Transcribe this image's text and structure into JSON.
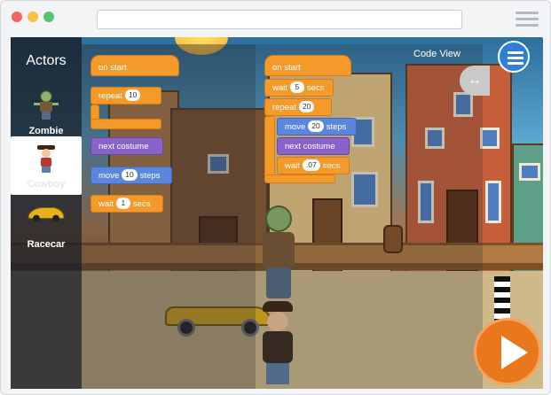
{
  "window": {
    "controls": [
      "close",
      "minimize",
      "zoom"
    ],
    "url": ""
  },
  "actors": {
    "title": "Actors",
    "items": [
      {
        "label": "Zombie",
        "icon": "zombie-icon"
      },
      {
        "label": "Cowboy",
        "icon": "cowboy-icon",
        "selected": true
      },
      {
        "label": "Racecar",
        "icon": "racecar-icon"
      }
    ]
  },
  "palette": {
    "on_start": "on start",
    "repeat": "repeat",
    "repeat_count": "10",
    "next_costume": "next costume",
    "move": "move",
    "move_value": "10",
    "move_unit": "steps",
    "wait": "wait",
    "wait_value": "1",
    "wait_unit": "secs"
  },
  "script": {
    "on_start": "on start",
    "wait": "wait",
    "wait_value": "5",
    "wait_unit": "secs",
    "repeat": "repeat",
    "repeat_count": "20",
    "move": "move",
    "move_value": "20",
    "move_unit": "steps",
    "next_costume": "next costume",
    "wait2": "wait",
    "wait2_value": ".07",
    "wait2_unit": "secs"
  },
  "code_view": {
    "label": "Code View"
  },
  "colors": {
    "motion": "#5b86dc",
    "looks": "#8a63c9",
    "control": "#f39a2b",
    "play": "#e9771c",
    "menu": "#2f7fd5"
  }
}
